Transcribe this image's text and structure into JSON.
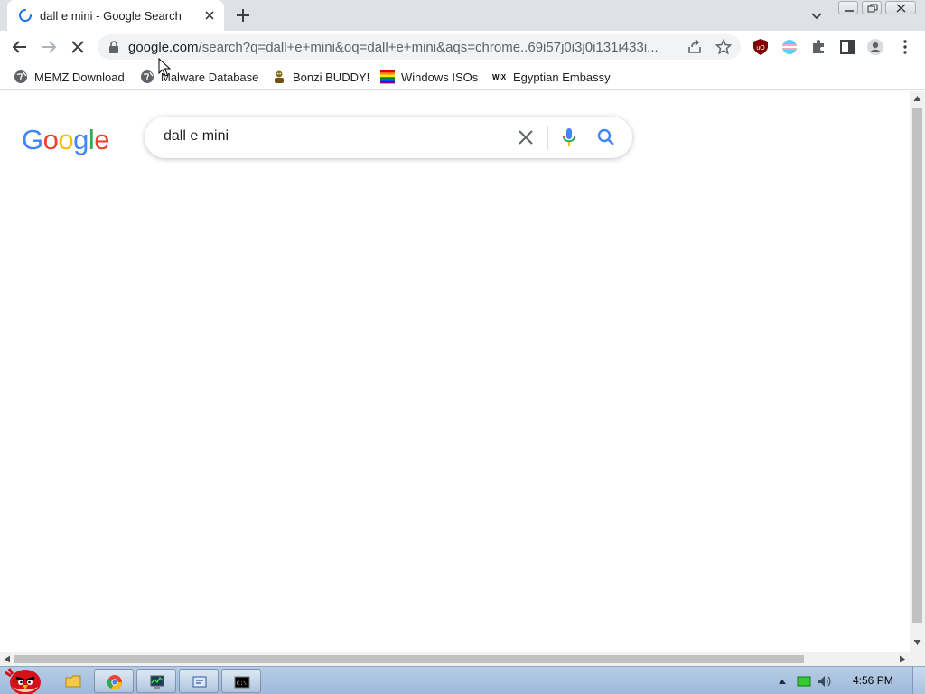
{
  "browser": {
    "tab": {
      "title": "dall e mini - Google Search"
    },
    "omnibox": {
      "host": "google.com",
      "path": "/search?q=dall+e+mini&oq=dall+e+mini&aqs=chrome..69i57j0i3j0i131i433i..."
    },
    "bookmarks": [
      {
        "label": "MEMZ Download",
        "icon": "globe-icon"
      },
      {
        "label": "Malware Database",
        "icon": "globe-icon"
      },
      {
        "label": "Bonzi BUDDY!",
        "icon": "bonzi-icon"
      },
      {
        "label": "Windows ISOs",
        "icon": "rainbow-flag-icon"
      },
      {
        "label": "Egyptian Embassy",
        "icon": "wix-icon"
      }
    ]
  },
  "page": {
    "logo": "Google",
    "search": {
      "query": "dall e mini"
    }
  },
  "taskbar": {
    "clock": "4:56 PM"
  },
  "colors": {
    "google_blue": "#4285F4",
    "google_red": "#EA4335",
    "google_yellow": "#FBBC05",
    "google_green": "#34A853",
    "tabstrip": "#dee1e6",
    "omnibox": "#f1f3f4"
  }
}
